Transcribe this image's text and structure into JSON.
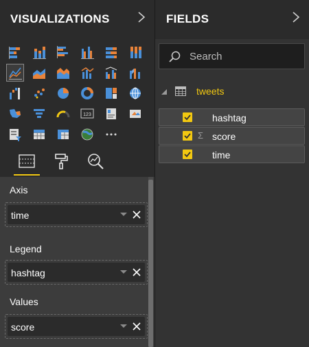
{
  "visualizations": {
    "title": "VISUALIZATIONS",
    "icons": [
      "stacked-bar-chart-icon",
      "stacked-column-chart-icon",
      "clustered-bar-chart-icon",
      "clustered-column-chart-icon",
      "100pct-stacked-bar-chart-icon",
      "100pct-stacked-column-chart-icon",
      "line-chart-icon",
      "area-chart-icon",
      "stacked-area-chart-icon",
      "line-and-stacked-column-chart-icon",
      "line-and-clustered-column-chart-icon",
      "ribbon-chart-icon",
      "waterfall-chart-icon",
      "scatter-chart-icon",
      "pie-chart-icon",
      "donut-chart-icon",
      "treemap-icon",
      "map-icon",
      "filled-map-icon",
      "funnel-icon",
      "gauge-icon",
      "card-icon",
      "multi-row-card-icon",
      "kpi-icon",
      "slicer-icon",
      "table-icon",
      "matrix-icon",
      "arcgis-map-icon",
      "more-visuals-icon"
    ],
    "selected_icon": "line-chart-icon",
    "subtabs": [
      "fields-well-tab",
      "format-tab",
      "analytics-tab"
    ],
    "wells": {
      "axis": {
        "label": "Axis",
        "value": "time"
      },
      "legend": {
        "label": "Legend",
        "value": "hashtag"
      },
      "values": {
        "label": "Values",
        "value": "score"
      }
    }
  },
  "fields": {
    "title": "FIELDS",
    "search_placeholder": "Search",
    "table": {
      "name": "tweets"
    },
    "items": [
      {
        "name": "hashtag",
        "checked": true,
        "sigma": ""
      },
      {
        "name": "score",
        "checked": true,
        "sigma": "Σ"
      },
      {
        "name": "time",
        "checked": true,
        "sigma": ""
      }
    ]
  },
  "colors": {
    "accent": "#f2c811",
    "chart_blue": "#4a90d9",
    "chart_orange": "#e8833a"
  }
}
